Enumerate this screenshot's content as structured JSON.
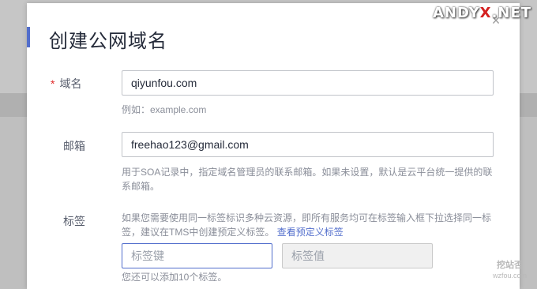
{
  "dialog": {
    "title": "创建公网域名",
    "close_glyph": "×"
  },
  "domain_field": {
    "required_mark": "*",
    "label": "域名",
    "value": "qiyunfou.com",
    "hint": "例如：example.com"
  },
  "email_field": {
    "label": "邮箱",
    "value": "freehao123@gmail.com",
    "hint": "用于SOA记录中，指定域名管理员的联系邮箱。如果未设置，默认是云平台统一提供的联系邮箱。"
  },
  "tags_field": {
    "label": "标签",
    "hint": "如果您需要使用同一标签标识多种云资源，即所有服务均可在标签输入框下拉选择同一标签，建议在TMS中创建预定义标签。",
    "link": "查看预定义标签",
    "key_placeholder": "标签键",
    "value_placeholder": "标签值",
    "count_hint": "您还可以添加10个标签。"
  },
  "watermark": {
    "text_a": "ANDY",
    "text_b": "X",
    "text_c": ".NET"
  },
  "corner_watermark": {
    "line1": "挖站否",
    "line2": "wzfou.com"
  },
  "colors": {
    "accent": "#526ecc",
    "required": "#e02828",
    "hint_text": "#8a8e99"
  }
}
